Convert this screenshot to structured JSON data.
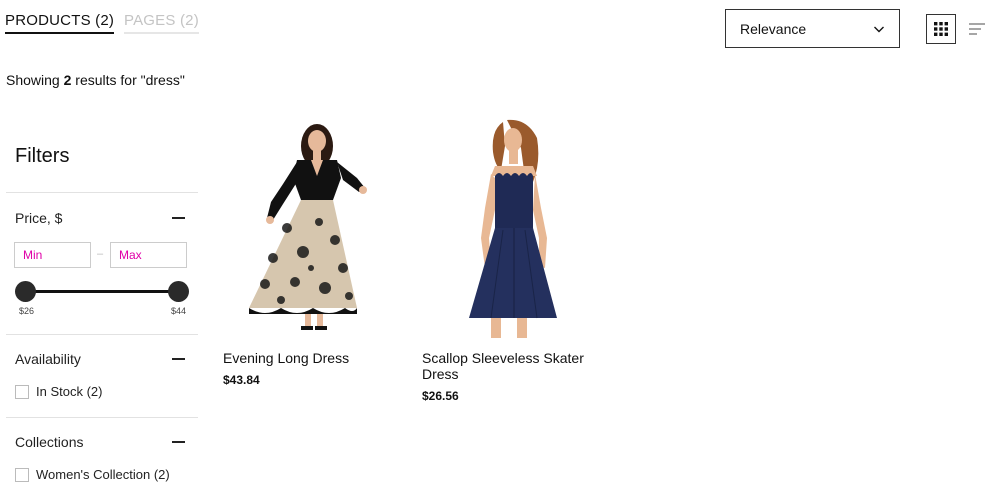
{
  "tabs": [
    {
      "label": "PRODUCTS",
      "count": "(2)"
    },
    {
      "label": "PAGES",
      "count": "(2)"
    }
  ],
  "sort": {
    "selected": "Relevance"
  },
  "results": {
    "prefix": "Showing",
    "count": "2",
    "suffix": "results for \"dress\""
  },
  "filters": {
    "title": "Filters",
    "price": {
      "title": "Price, $",
      "min_placeholder": "Min",
      "max_placeholder": "Max",
      "dash": "–",
      "range_min_label": "$26",
      "range_max_label": "$44",
      "range_min": 26,
      "range_max": 44
    },
    "availability": {
      "title": "Availability",
      "options": [
        {
          "label": "In Stock (2)"
        }
      ]
    },
    "collections": {
      "title": "Collections",
      "options": [
        {
          "label": "Women's Collection (2)"
        }
      ]
    }
  },
  "products": [
    {
      "name": "Evening Long Dress",
      "price": "$43.84"
    },
    {
      "name": "Scallop Sleeveless Skater Dress",
      "price": "$26.56"
    }
  ],
  "colors": {
    "accent": "#e000a8",
    "text": "#111111",
    "muted_tab": "#c4c4c4",
    "dress_navy": "#1f2a55"
  }
}
